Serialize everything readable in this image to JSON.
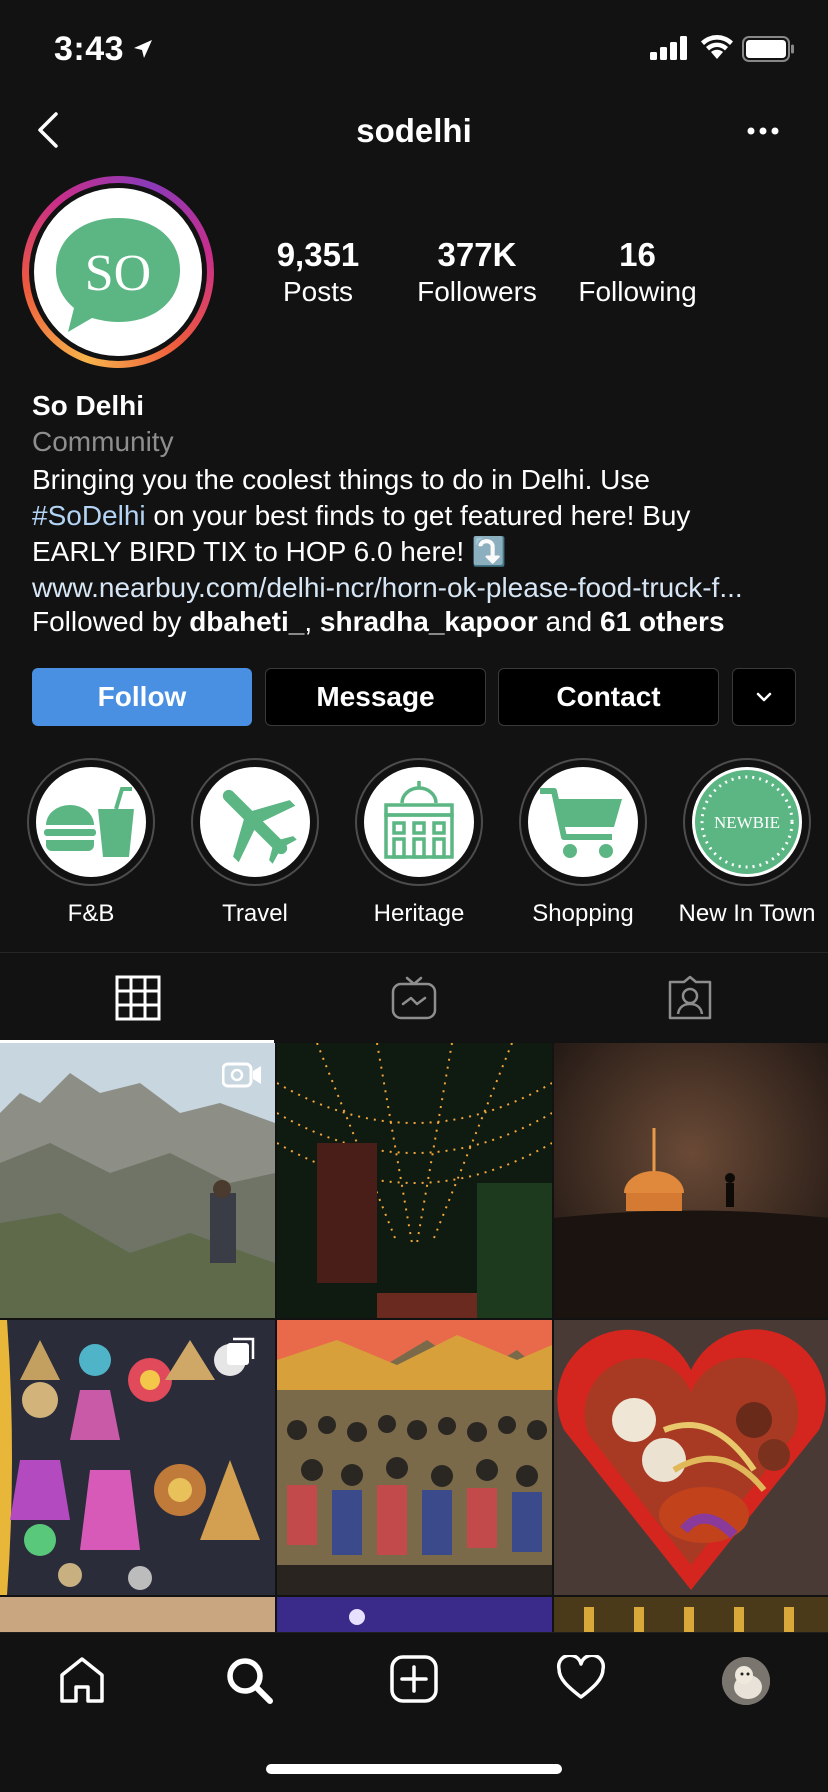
{
  "status_bar": {
    "time": "3:43"
  },
  "header": {
    "username": "sodelhi"
  },
  "profile": {
    "avatar_text": "SO",
    "stats": [
      {
        "value": "9,351",
        "label": "Posts"
      },
      {
        "value": "377K",
        "label": "Followers"
      },
      {
        "value": "16",
        "label": "Following"
      }
    ],
    "name": "So Delhi",
    "category": "Community",
    "bio": {
      "line1": "Bringing you the coolest things to do in Delhi. Use",
      "hashtag": "#SoDelhi",
      "line2_rest": " on your best finds to get featured here! Buy",
      "line3": "EARLY BIRD TIX to HOP 6.0 here! ⤵️"
    },
    "link": "www.nearbuy.com/delhi-ncr/horn-ok-please-food-truck-f...",
    "followed_by": {
      "prefix": "Followed by ",
      "user1": "dbaheti_",
      "sep": ", ",
      "user2": "shradha_kapoor",
      "mid": " and ",
      "others": "61 others"
    }
  },
  "actions": {
    "follow": "Follow",
    "message": "Message",
    "contact": "Contact"
  },
  "highlights": [
    {
      "label": "F&B",
      "icon": "burger-drink-icon"
    },
    {
      "label": "Travel",
      "icon": "airplane-icon"
    },
    {
      "label": "Heritage",
      "icon": "building-icon"
    },
    {
      "label": "Shopping",
      "icon": "cart-icon"
    },
    {
      "label": "New In Town",
      "icon": "newbie-badge-icon",
      "badge_text": "NEWBIE"
    }
  ],
  "tabs": [
    "grid-icon",
    "igtv-icon",
    "tagged-icon"
  ],
  "colors": {
    "accent": "#4a90e2",
    "brand_green": "#5bb683",
    "background": "#121212"
  }
}
